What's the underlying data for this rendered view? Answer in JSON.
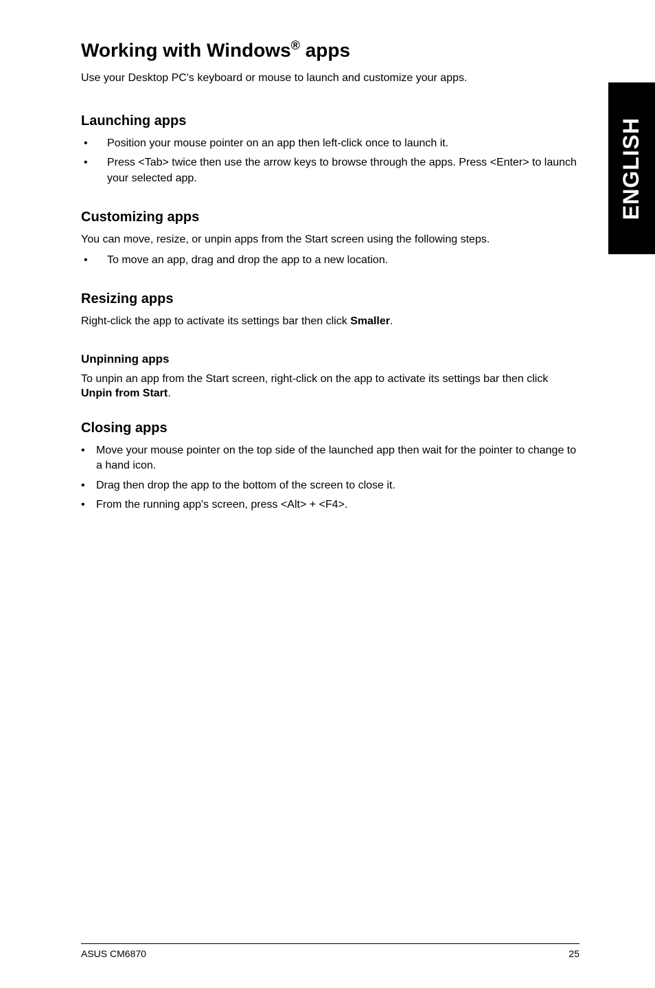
{
  "sideTab": "ENGLISH",
  "title": {
    "pre": "Working with Windows",
    "reg": "®",
    "post": " apps"
  },
  "intro": "Use your Desktop PC's keyboard or mouse to launch and customize your apps.",
  "sections": {
    "launching": {
      "heading": "Launching apps",
      "items": [
        "Position your mouse pointer on an app then left-click once to launch it.",
        "Press <Tab> twice then use the arrow keys to browse through the apps. Press <Enter> to launch your selected app."
      ]
    },
    "customizing": {
      "heading": "Customizing apps",
      "desc": "You can move, resize, or unpin apps from the Start screen using the following steps.",
      "items": [
        "To move an app, drag and drop the app to a new location."
      ]
    },
    "resizing": {
      "heading": "Resizing apps",
      "desc_pre": "Right-click the app to activate its settings bar then click ",
      "desc_bold": "Smaller",
      "desc_post": "."
    },
    "unpinning": {
      "heading": "Unpinning apps",
      "desc_pre": "To unpin an app from the Start screen, right-click on the app to activate its settings bar then click ",
      "desc_bold": "Unpin from Start",
      "desc_post": "."
    },
    "closing": {
      "heading": "Closing apps",
      "items": [
        "Move your mouse pointer on the top side of the launched app then wait for the pointer to change to a hand icon.",
        "Drag then drop the app to the bottom of the screen to close it.",
        "From the running app's screen, press <Alt> + <F4>."
      ]
    }
  },
  "footer": {
    "left": "ASUS CM6870",
    "right": "25"
  }
}
